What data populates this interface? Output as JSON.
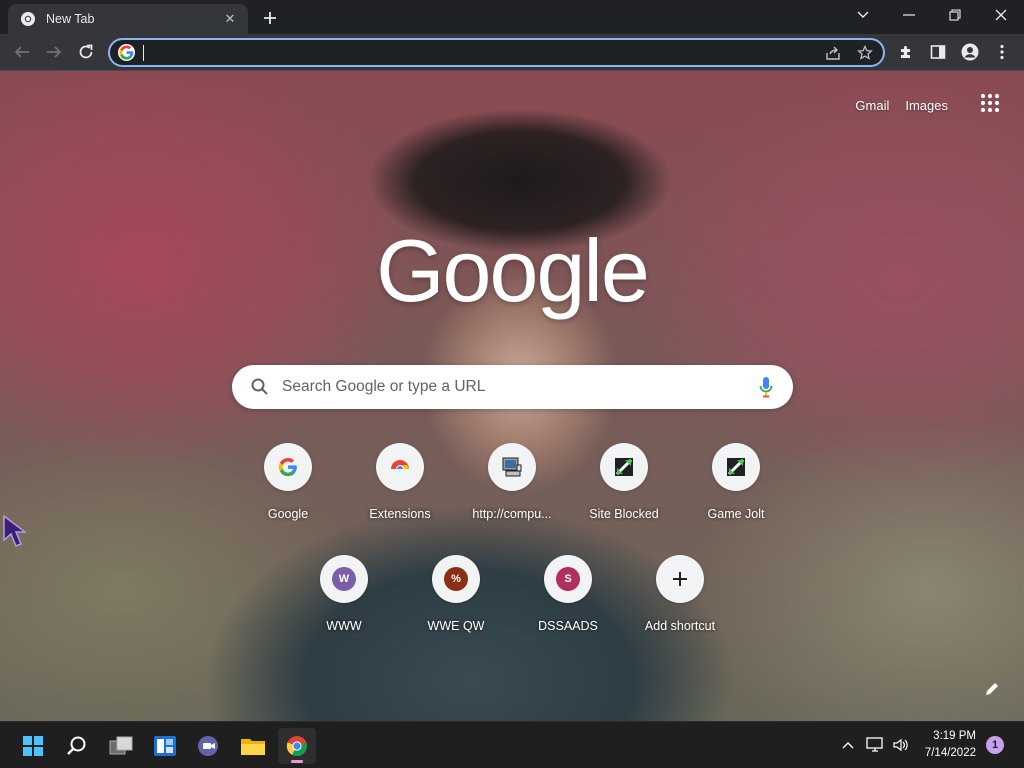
{
  "tab": {
    "title": "New Tab",
    "close_symbol": "✕"
  },
  "window": {
    "new_tab_symbol": "+"
  },
  "omnibox": {
    "value": "",
    "placeholder": ""
  },
  "top_links": {
    "gmail": "Gmail",
    "images": "Images"
  },
  "logo_text": "Google",
  "search": {
    "placeholder": "Search Google or type a URL"
  },
  "shortcuts_row1": [
    {
      "label": "Google",
      "icon": "google-g-icon"
    },
    {
      "label": "Extensions",
      "icon": "chrome-extensions-icon"
    },
    {
      "label": "http://compu...",
      "icon": "computer-icon"
    },
    {
      "label": "Site Blocked",
      "icon": "blocked-site-icon"
    },
    {
      "label": "Game Jolt",
      "icon": "game-jolt-icon"
    }
  ],
  "shortcuts_row2": [
    {
      "label": "WWW",
      "letter": "W",
      "color": "#7b5ea7"
    },
    {
      "label": "WWE QW",
      "letter": "%",
      "color": "#8a2f12"
    },
    {
      "label": "DSSAADS",
      "letter": "S",
      "color": "#b03060"
    },
    {
      "label": "Add shortcut",
      "letter": "+"
    }
  ],
  "taskbar": {
    "time": "3:19 PM",
    "date": "7/14/2022",
    "notifications": "1"
  },
  "colors": {
    "accent": "#8ab4f8",
    "toolbar": "#35363a",
    "frame": "#202124",
    "taskbar": "#1f1f1f"
  }
}
